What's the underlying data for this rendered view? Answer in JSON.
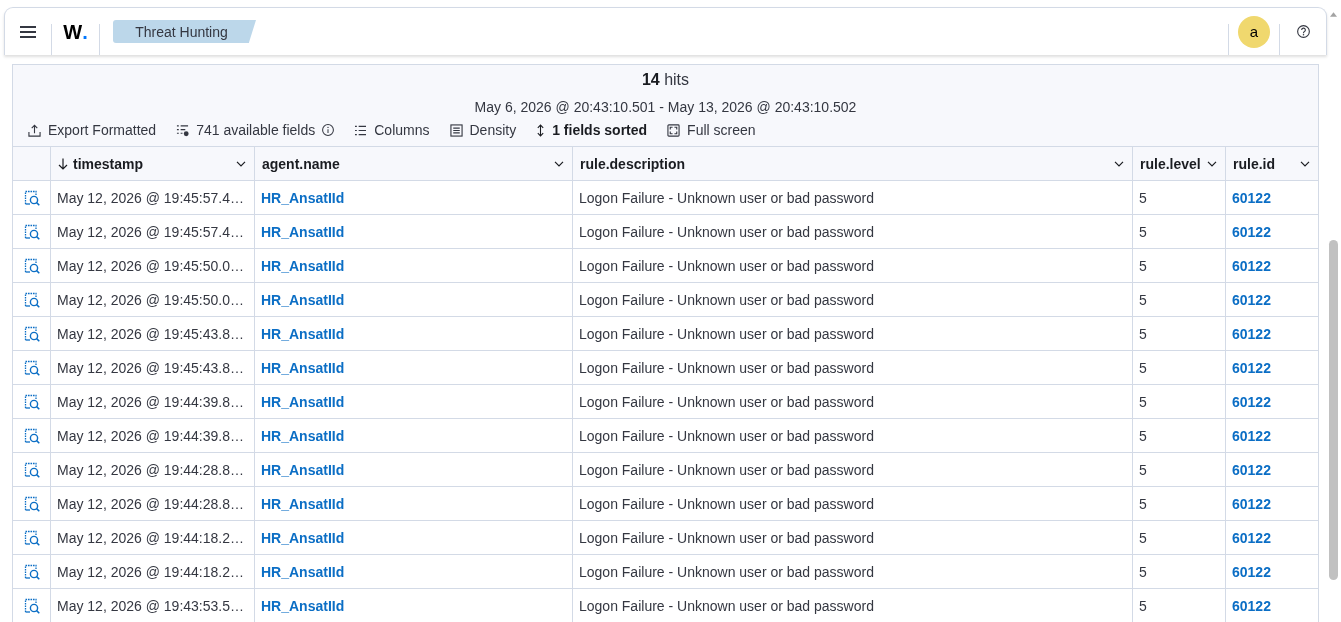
{
  "header": {
    "logo": {
      "text": "W",
      "mark": "."
    },
    "breadcrumb": "Threat Hunting",
    "avatar": "a"
  },
  "results": {
    "hits": "**14** hits",
    "time_range": "May 6, 2026 @ 20:43:10.501 - May 13, 2026 @ 20:43:10.502"
  },
  "toolbar": [
    {
      "kind": "export",
      "label": "Export Formatted",
      "active": false,
      "info": false
    },
    {
      "kind": "fields",
      "label": "741 available fields",
      "active": false,
      "info": true
    },
    {
      "kind": "columns",
      "label": "Columns",
      "active": false,
      "info": false
    },
    {
      "kind": "density",
      "label": "Density",
      "active": false,
      "info": false
    },
    {
      "kind": "sort",
      "label": "1 fields sorted",
      "active": true,
      "info": false
    },
    {
      "kind": "fullscreen",
      "label": "Full screen",
      "active": false,
      "info": false
    }
  ],
  "table": {
    "columns": [
      {
        "label": "timestamp",
        "kind": "text",
        "sorted": true
      },
      {
        "label": "agent.name",
        "kind": "link",
        "sorted": false
      },
      {
        "label": "rule.description",
        "kind": "text",
        "sorted": false
      },
      {
        "label": "rule.level",
        "kind": "text",
        "sorted": false
      },
      {
        "label": "rule.id",
        "kind": "link",
        "sorted": false
      }
    ],
    "rows": [
      [
        "May 12, 2026 @ 19:45:57.4…",
        "HR_AnsatIId",
        "Logon Failure - Unknown user or bad password",
        "5",
        "60122"
      ],
      [
        "May 12, 2026 @ 19:45:57.4…",
        "HR_AnsatIId",
        "Logon Failure - Unknown user or bad password",
        "5",
        "60122"
      ],
      [
        "May 12, 2026 @ 19:45:50.0…",
        "HR_AnsatIId",
        "Logon Failure - Unknown user or bad password",
        "5",
        "60122"
      ],
      [
        "May 12, 2026 @ 19:45:50.0…",
        "HR_AnsatIId",
        "Logon Failure - Unknown user or bad password",
        "5",
        "60122"
      ],
      [
        "May 12, 2026 @ 19:45:43.8…",
        "HR_AnsatIId",
        "Logon Failure - Unknown user or bad password",
        "5",
        "60122"
      ],
      [
        "May 12, 2026 @ 19:45:43.8…",
        "HR_AnsatIId",
        "Logon Failure - Unknown user or bad password",
        "5",
        "60122"
      ],
      [
        "May 12, 2026 @ 19:44:39.8…",
        "HR_AnsatIId",
        "Logon Failure - Unknown user or bad password",
        "5",
        "60122"
      ],
      [
        "May 12, 2026 @ 19:44:39.8…",
        "HR_AnsatIId",
        "Logon Failure - Unknown user or bad password",
        "5",
        "60122"
      ],
      [
        "May 12, 2026 @ 19:44:28.8…",
        "HR_AnsatIId",
        "Logon Failure - Unknown user or bad password",
        "5",
        "60122"
      ],
      [
        "May 12, 2026 @ 19:44:28.8…",
        "HR_AnsatIId",
        "Logon Failure - Unknown user or bad password",
        "5",
        "60122"
      ],
      [
        "May 12, 2026 @ 19:44:18.2…",
        "HR_AnsatIId",
        "Logon Failure - Unknown user or bad password",
        "5",
        "60122"
      ],
      [
        "May 12, 2026 @ 19:44:18.2…",
        "HR_AnsatIId",
        "Logon Failure - Unknown user or bad password",
        "5",
        "60122"
      ],
      [
        "May 12, 2026 @ 19:43:53.5…",
        "HR_AnsatIId",
        "Logon Failure - Unknown user or bad password",
        "5",
        "60122"
      ]
    ]
  }
}
